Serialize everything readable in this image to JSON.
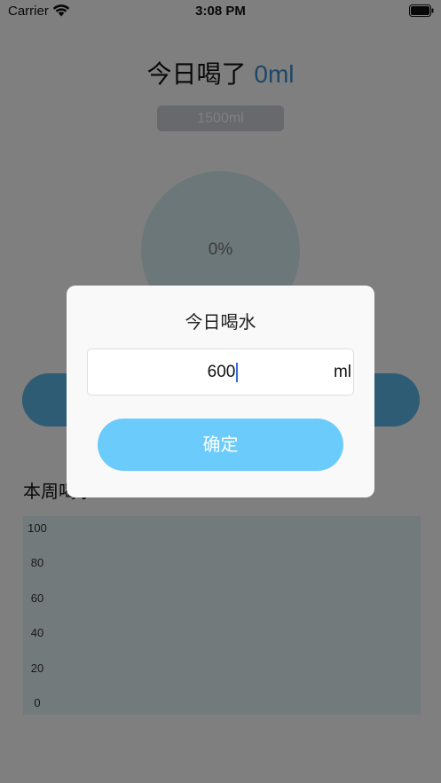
{
  "status_bar": {
    "carrier": "Carrier",
    "time": "3:08 PM",
    "icons": [
      "wifi-icon",
      "battery-icon"
    ]
  },
  "header": {
    "title_prefix": "今日喝了",
    "amount": "0ml",
    "goal_button_label": "1500ml"
  },
  "progress": {
    "percent_label": "0%",
    "fill_fraction": 0
  },
  "weekly": {
    "title": "本周喝水"
  },
  "chart_data": {
    "type": "bar",
    "categories": [],
    "values": [],
    "title": "",
    "xlabel": "",
    "ylabel": "",
    "ylim": [
      0,
      100
    ],
    "yticks": [
      "100",
      "80",
      "60",
      "40",
      "20",
      "0"
    ]
  },
  "dialog": {
    "title": "今日喝水",
    "input_value": "600",
    "unit": "ml",
    "confirm_label": "确定"
  },
  "colors": {
    "accent": "#3a8fd4",
    "confirm_button": "#6bcbfa",
    "drink_button": "#5fb9ea",
    "goal_button": "#d0d2da",
    "chart_background": "#e7f4f7",
    "circle_background": "#d9eef2",
    "caret": "#2f6de0"
  }
}
